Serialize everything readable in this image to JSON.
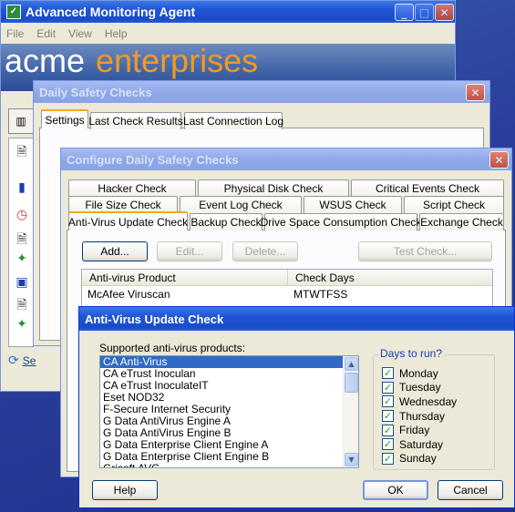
{
  "agent": {
    "title": "Advanced Monitoring Agent",
    "menu": [
      "File",
      "Edit",
      "View",
      "Help"
    ],
    "banner_left": "acme",
    "banner_right": "enterprises",
    "brand_blue": "#1a3fa8",
    "brand_orange": "#f39a1e",
    "link_prefix": "Se"
  },
  "safety": {
    "title": "Daily Safety Checks",
    "tabs": [
      "Settings",
      "Last Check Results",
      "Last Connection Log"
    ]
  },
  "configure": {
    "title": "Configure Daily Safety Checks",
    "tabs_row1": [
      "Hacker Check",
      "Physical Disk Check",
      "Critical Events Check"
    ],
    "tabs_row2": [
      "File Size Check",
      "Event Log Check",
      "WSUS Check",
      "Script Check"
    ],
    "tabs_row3": [
      "Anti-Virus Update Check",
      "Backup Check",
      "Drive Space Consumption Check",
      "Exchange Check"
    ],
    "buttons": {
      "add": "Add...",
      "edit": "Edit...",
      "delete": "Delete...",
      "test": "Test Check..."
    },
    "columns": [
      "Anti-virus Product",
      "Check Days"
    ],
    "rows": [
      {
        "product": "McAfee Viruscan",
        "days": "MTWTFSS"
      }
    ]
  },
  "avdialog": {
    "title": "Anti-Virus Update Check",
    "supported_label": "Supported anti-virus products:",
    "products": [
      "CA Anti-Virus",
      "CA eTrust Inoculan",
      "CA eTrust InoculateIT",
      "Eset NOD32",
      "F-Secure Internet Security",
      "G Data AntiVirus Engine A",
      "G Data AntiVirus Engine B",
      "G Data Enterprise Client Engine A",
      "G Data Enterprise Client Engine B",
      "Grisoft AVG"
    ],
    "selected_index": 0,
    "days_label": "Days to run?",
    "days": [
      {
        "name": "Monday",
        "checked": true
      },
      {
        "name": "Tuesday",
        "checked": true
      },
      {
        "name": "Wednesday",
        "checked": true
      },
      {
        "name": "Thursday",
        "checked": true
      },
      {
        "name": "Friday",
        "checked": true
      },
      {
        "name": "Saturday",
        "checked": true
      },
      {
        "name": "Sunday",
        "checked": true
      }
    ],
    "help": "Help",
    "ok": "OK",
    "cancel": "Cancel"
  }
}
